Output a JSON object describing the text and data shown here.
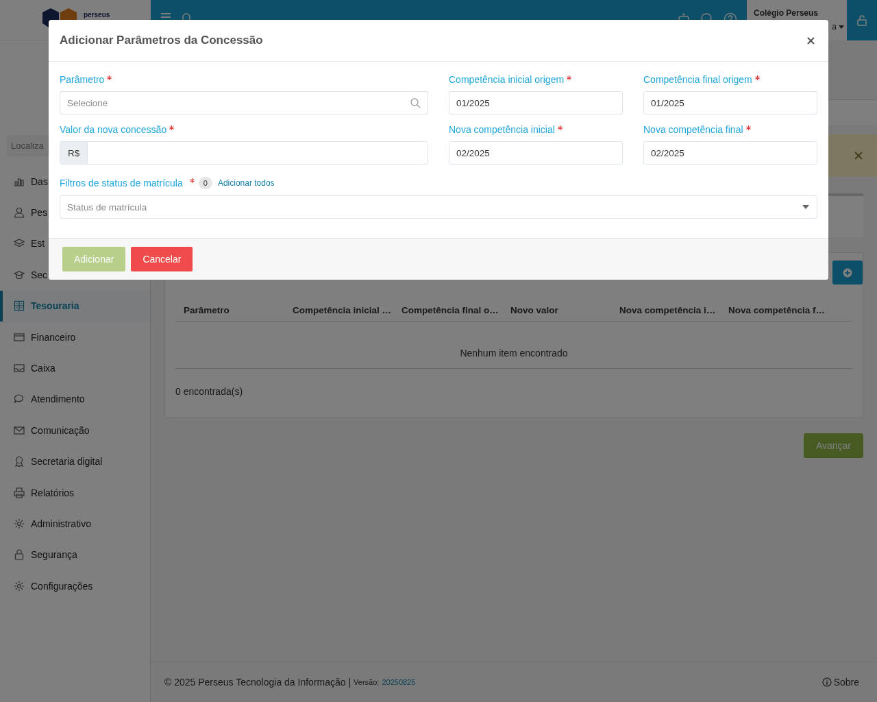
{
  "header": {
    "logo_text": "perseus",
    "school": "Colégio Perseus",
    "user_name": "a"
  },
  "sidebar": {
    "search_placeholder": "Localiza",
    "items": [
      {
        "label": "Das",
        "selected": false
      },
      {
        "label": "Pes",
        "selected": false
      },
      {
        "label": "Est",
        "selected": false
      },
      {
        "label": "Sec",
        "selected": false
      },
      {
        "label": "Tesouraria",
        "selected": true
      },
      {
        "label": "Financeiro",
        "selected": false
      },
      {
        "label": "Caixa",
        "selected": false
      },
      {
        "label": "Atendimento",
        "selected": false
      },
      {
        "label": "Comunicação",
        "selected": false
      },
      {
        "label": "Secretaria digital",
        "selected": false
      },
      {
        "label": "Relatórios",
        "selected": false
      },
      {
        "label": "Administrativo",
        "selected": false
      },
      {
        "label": "Segurança",
        "selected": false
      },
      {
        "label": "Configurações",
        "selected": false
      }
    ]
  },
  "content": {
    "table": {
      "columns": [
        "Parâmetro",
        "Competência inicial …",
        "Competência final o…",
        "Novo valor",
        "Nova competência i…",
        "Nova competência f…"
      ],
      "empty_text": "Nenhum item encontrado"
    },
    "count": "0 encontrada(s)",
    "next_button": "Avançar"
  },
  "footer": {
    "copyright": "© 2025 Perseus Tecnologia da Informação |",
    "version_label": "Versão:",
    "version": "20250825",
    "about": "Sobre"
  },
  "modal": {
    "title": "Adicionar Parâmetros da Concessão",
    "fields": [
      {
        "kind": "search",
        "label": "Parâmetro",
        "required": true,
        "placeholder": "Selecione"
      },
      {
        "kind": "text",
        "label": "Competência inicial origem",
        "required": true,
        "value": "01/2025"
      },
      {
        "kind": "text",
        "label": "Competência final origem",
        "required": true,
        "value": "01/2025"
      },
      {
        "kind": "currency",
        "label": "Valor da nova concessão",
        "required": true,
        "prefix": "R$"
      },
      {
        "kind": "text",
        "label": "Nova competência inicial",
        "required": true,
        "value": "02/2025"
      },
      {
        "kind": "text",
        "label": "Nova competência final",
        "required": true,
        "value": "02/2025"
      }
    ],
    "filter": {
      "label": "Filtros de status de matrícula",
      "required": true,
      "count": "0",
      "link": "Adicionar todos",
      "placeholder": "Status de matrícula"
    },
    "buttons": [
      {
        "kind": "primary",
        "label": "Adicionar",
        "disabled": true
      },
      {
        "kind": "danger",
        "label": "Cancelar",
        "disabled": false
      }
    ]
  }
}
